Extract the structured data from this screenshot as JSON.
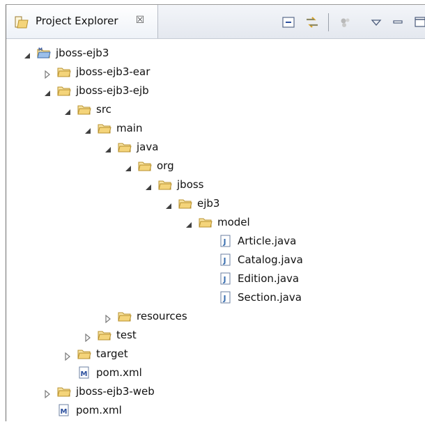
{
  "view": {
    "title": "Project Explorer",
    "close_glyph": "☒"
  },
  "toolbar": {
    "icons": [
      "collapse-all-icon",
      "link-with-editor-icon",
      "focus-on-active-task-icon",
      "view-menu-icon",
      "minimize-icon",
      "maximize-icon"
    ]
  },
  "tree": {
    "items": [
      {
        "label": "jboss-ejb3",
        "icon": "maven-project-folder-icon",
        "state": "expanded"
      },
      {
        "label": "jboss-ejb3-ear",
        "icon": "folder-icon",
        "state": "collapsed"
      },
      {
        "label": "jboss-ejb3-ejb",
        "icon": "folder-icon",
        "state": "expanded"
      },
      {
        "label": "src",
        "icon": "folder-icon",
        "state": "expanded"
      },
      {
        "label": "main",
        "icon": "folder-icon",
        "state": "expanded"
      },
      {
        "label": "java",
        "icon": "folder-icon",
        "state": "expanded"
      },
      {
        "label": "org",
        "icon": "folder-icon",
        "state": "expanded"
      },
      {
        "label": "jboss",
        "icon": "folder-icon",
        "state": "expanded"
      },
      {
        "label": "ejb3",
        "icon": "folder-icon",
        "state": "expanded"
      },
      {
        "label": "model",
        "icon": "folder-icon",
        "state": "expanded"
      },
      {
        "label": "Article.java",
        "icon": "java-file-icon",
        "state": "leaf"
      },
      {
        "label": "Catalog.java",
        "icon": "java-file-icon",
        "state": "leaf"
      },
      {
        "label": "Edition.java",
        "icon": "java-file-icon",
        "state": "leaf"
      },
      {
        "label": "Section.java",
        "icon": "java-file-icon",
        "state": "leaf"
      },
      {
        "label": "resources",
        "icon": "folder-icon",
        "state": "collapsed"
      },
      {
        "label": "test",
        "icon": "folder-icon",
        "state": "collapsed"
      },
      {
        "label": "target",
        "icon": "folder-icon",
        "state": "collapsed"
      },
      {
        "label": "pom.xml",
        "icon": "maven-pom-file-icon",
        "state": "leaf"
      },
      {
        "label": "jboss-ejb3-web",
        "icon": "folder-icon",
        "state": "collapsed"
      },
      {
        "label": "pom.xml",
        "icon": "maven-pom-file-icon",
        "state": "leaf"
      }
    ]
  },
  "colors": {
    "folder_fill": "#f4d47a",
    "folder_stroke": "#b8912e",
    "java_icon_blue": "#3a6fb0",
    "maven_icon_blue": "#2b4f9e",
    "toggle_gray": "#7a7a7a"
  }
}
